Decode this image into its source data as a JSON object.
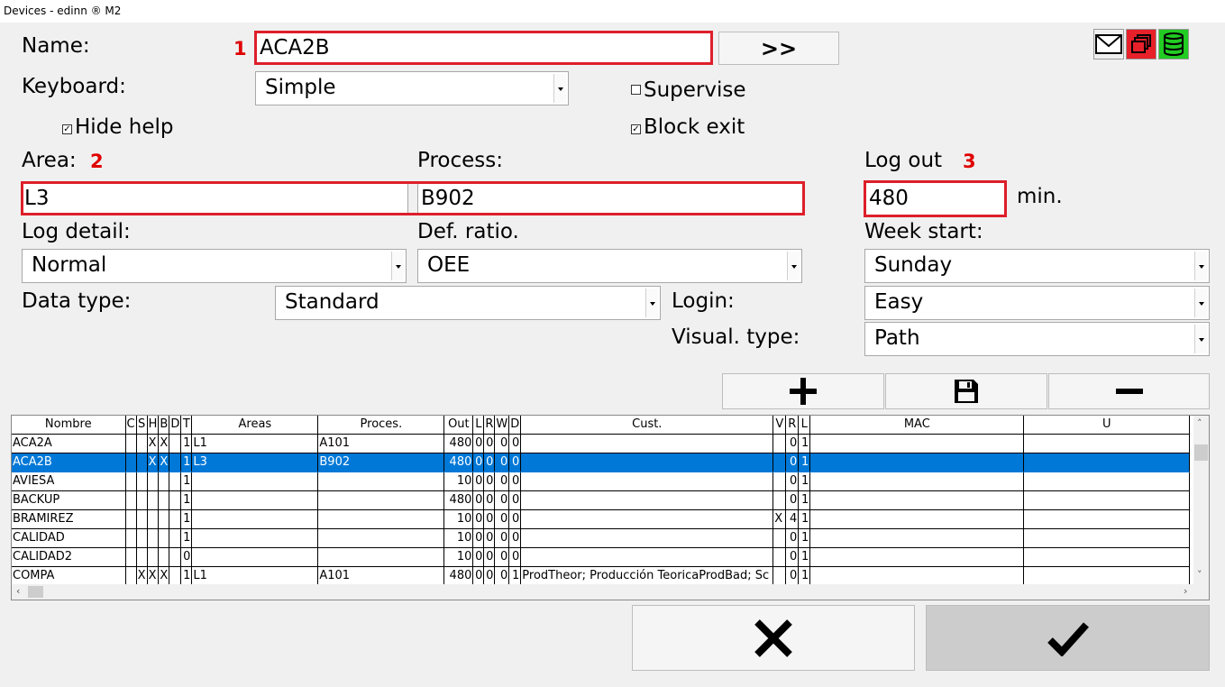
{
  "window": {
    "title": "Devices - edinn ® M2"
  },
  "form": {
    "name_label": "Name:",
    "name_value": "ACA2B",
    "more_button": ">>",
    "keyboard_label": "Keyboard:",
    "keyboard_value": "Simple",
    "supervise_label": "Supervise",
    "supervise_checked": false,
    "hide_help_label": "Hide help",
    "hide_help_checked": true,
    "block_exit_label": "Block exit",
    "block_exit_checked": true,
    "area_label": "Area:",
    "area_value": "L3",
    "process_label": "Process:",
    "process_value": "B902",
    "logout_label": "Log out",
    "logout_value": "480",
    "logout_unit": "min.",
    "log_detail_label": "Log detail:",
    "log_detail_value": "Normal",
    "def_ratio_label": "Def. ratio.",
    "def_ratio_value": "OEE",
    "week_start_label": "Week start:",
    "week_start_value": "Sunday",
    "data_type_label": "Data type:",
    "data_type_value": "Standard",
    "login_label": "Login:",
    "login_value": "Easy",
    "visual_type_label": "Visual. type:",
    "visual_type_value": "Path"
  },
  "annotations": {
    "n1": "1",
    "n2": "2",
    "n3": "3"
  },
  "icons": {
    "mail": "mail-icon",
    "copy": "copy-windows-icon",
    "database": "database-icon",
    "add": "plus-icon",
    "save": "floppy-disk-icon",
    "remove": "minus-icon",
    "cancel": "x-icon",
    "accept": "checkmark-icon"
  },
  "colors": {
    "highlight": "#dd1f2a",
    "selection": "#0078d7",
    "copy_icon_bg": "#e8202a",
    "db_icon_bg": "#22cc22"
  },
  "table": {
    "columns": [
      "Nombre",
      "C",
      "S",
      "H",
      "B",
      "D",
      "T",
      "Areas",
      "Proces.",
      "Out",
      "L",
      "R",
      "W",
      "D",
      "Cust.",
      "V",
      "R",
      "L",
      "MAC",
      "U"
    ],
    "rows": [
      [
        "ACA2A",
        "",
        "",
        "X",
        "X",
        "",
        "1",
        "L1",
        "A101",
        "480",
        "0",
        "0",
        "0",
        "0",
        "",
        "",
        "0",
        "1",
        "",
        ""
      ],
      [
        "ACA2B",
        "",
        "",
        "X",
        "X",
        "",
        "1",
        "L3",
        "B902",
        "480",
        "0",
        "0",
        "0",
        "0",
        "",
        "",
        "0",
        "1",
        "",
        ""
      ],
      [
        "AVIESA",
        "",
        "",
        "",
        "",
        "",
        "1",
        "",
        "",
        "10",
        "0",
        "0",
        "0",
        "0",
        "",
        "",
        "0",
        "1",
        "",
        ""
      ],
      [
        "BACKUP",
        "",
        "",
        "",
        "",
        "",
        "1",
        "",
        "",
        "480",
        "0",
        "0",
        "0",
        "0",
        "",
        "",
        "0",
        "1",
        "",
        ""
      ],
      [
        "BRAMIREZ",
        "",
        "",
        "",
        "",
        "",
        "1",
        "",
        "",
        "10",
        "0",
        "0",
        "0",
        "0",
        "",
        "X",
        "4",
        "1",
        "",
        ""
      ],
      [
        "CALIDAD",
        "",
        "",
        "",
        "",
        "",
        "1",
        "",
        "",
        "10",
        "0",
        "0",
        "0",
        "0",
        "",
        "",
        "0",
        "1",
        "",
        ""
      ],
      [
        "CALIDAD2",
        "",
        "",
        "",
        "",
        "",
        "0",
        "",
        "",
        "10",
        "0",
        "0",
        "0",
        "0",
        "",
        "",
        "0",
        "1",
        "",
        ""
      ],
      [
        "COMPA",
        "",
        "X",
        "X",
        "X",
        "",
        "1",
        "L1",
        "A101",
        "480",
        "0",
        "0",
        "0",
        "1",
        "ProdTheor; Producción TeoricaProdBad; Sc",
        "",
        "0",
        "1",
        "",
        ""
      ]
    ],
    "selected_row": 1
  }
}
